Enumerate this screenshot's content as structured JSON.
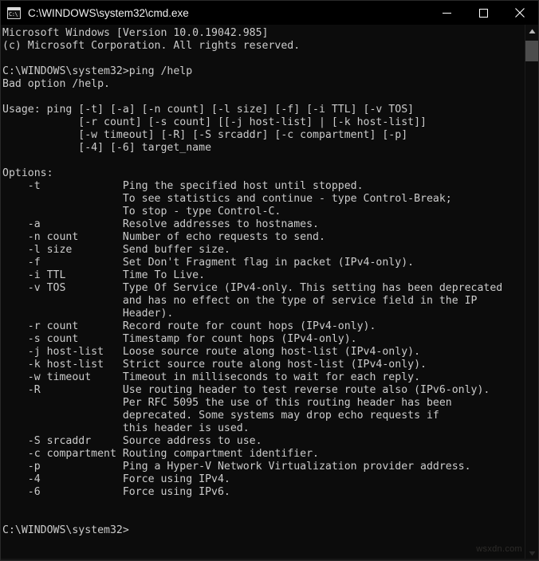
{
  "window": {
    "title": "C:\\WINDOWS\\system32\\cmd.exe",
    "icon_label": "C:\\",
    "icon_name": "cmd-console-icon",
    "background_color": "#0c0c0c",
    "text_color": "#cccccc",
    "titlebar_color": "#000000",
    "controls": {
      "minimize": "Minimize",
      "maximize": "Maximize",
      "close": "Close"
    }
  },
  "scrollbar": {
    "up_arrow": "scroll-up",
    "down_arrow": "scroll-down",
    "thumb_label": "scroll-thumb"
  },
  "watermark": {
    "text": "wsxdn.com"
  },
  "terminal": {
    "banner": [
      "Microsoft Windows [Version 10.0.19042.985]",
      "(c) Microsoft Corporation. All rights reserved."
    ],
    "prompt_path": "C:\\WINDOWS\\system32>",
    "command": "ping /help",
    "error": "Bad option /help.",
    "usage": [
      "Usage: ping [-t] [-a] [-n count] [-l size] [-f] [-i TTL] [-v TOS]",
      "            [-r count] [-s count] [[-j host-list] | [-k host-list]]",
      "            [-w timeout] [-R] [-S srcaddr] [-c compartment] [-p]",
      "            [-4] [-6] target_name"
    ],
    "options_header": "Options:",
    "options": [
      {
        "flag": "-t",
        "desc": [
          "Ping the specified host until stopped.",
          "To see statistics and continue - type Control-Break;",
          "To stop - type Control-C."
        ]
      },
      {
        "flag": "-a",
        "desc": [
          "Resolve addresses to hostnames."
        ]
      },
      {
        "flag": "-n count",
        "desc": [
          "Number of echo requests to send."
        ]
      },
      {
        "flag": "-l size",
        "desc": [
          "Send buffer size."
        ]
      },
      {
        "flag": "-f",
        "desc": [
          "Set Don't Fragment flag in packet (IPv4-only)."
        ]
      },
      {
        "flag": "-i TTL",
        "desc": [
          "Time To Live."
        ]
      },
      {
        "flag": "-v TOS",
        "desc": [
          "Type Of Service (IPv4-only. This setting has been deprecated",
          "and has no effect on the type of service field in the IP",
          "Header)."
        ]
      },
      {
        "flag": "-r count",
        "desc": [
          "Record route for count hops (IPv4-only)."
        ]
      },
      {
        "flag": "-s count",
        "desc": [
          "Timestamp for count hops (IPv4-only)."
        ]
      },
      {
        "flag": "-j host-list",
        "desc": [
          "Loose source route along host-list (IPv4-only)."
        ]
      },
      {
        "flag": "-k host-list",
        "desc": [
          "Strict source route along host-list (IPv4-only)."
        ]
      },
      {
        "flag": "-w timeout",
        "desc": [
          "Timeout in milliseconds to wait for each reply."
        ]
      },
      {
        "flag": "-R",
        "desc": [
          "Use routing header to test reverse route also (IPv6-only).",
          "Per RFC 5095 the use of this routing header has been",
          "deprecated. Some systems may drop echo requests if",
          "this header is used."
        ]
      },
      {
        "flag": "-S srcaddr",
        "desc": [
          "Source address to use."
        ]
      },
      {
        "flag": "-c compartment",
        "desc": [
          "Routing compartment identifier."
        ]
      },
      {
        "flag": "-p",
        "desc": [
          "Ping a Hyper-V Network Virtualization provider address."
        ]
      },
      {
        "flag": "-4",
        "desc": [
          "Force using IPv4."
        ]
      },
      {
        "flag": "-6",
        "desc": [
          "Force using IPv6."
        ]
      }
    ],
    "final_prompt": "C:\\WINDOWS\\system32>"
  }
}
